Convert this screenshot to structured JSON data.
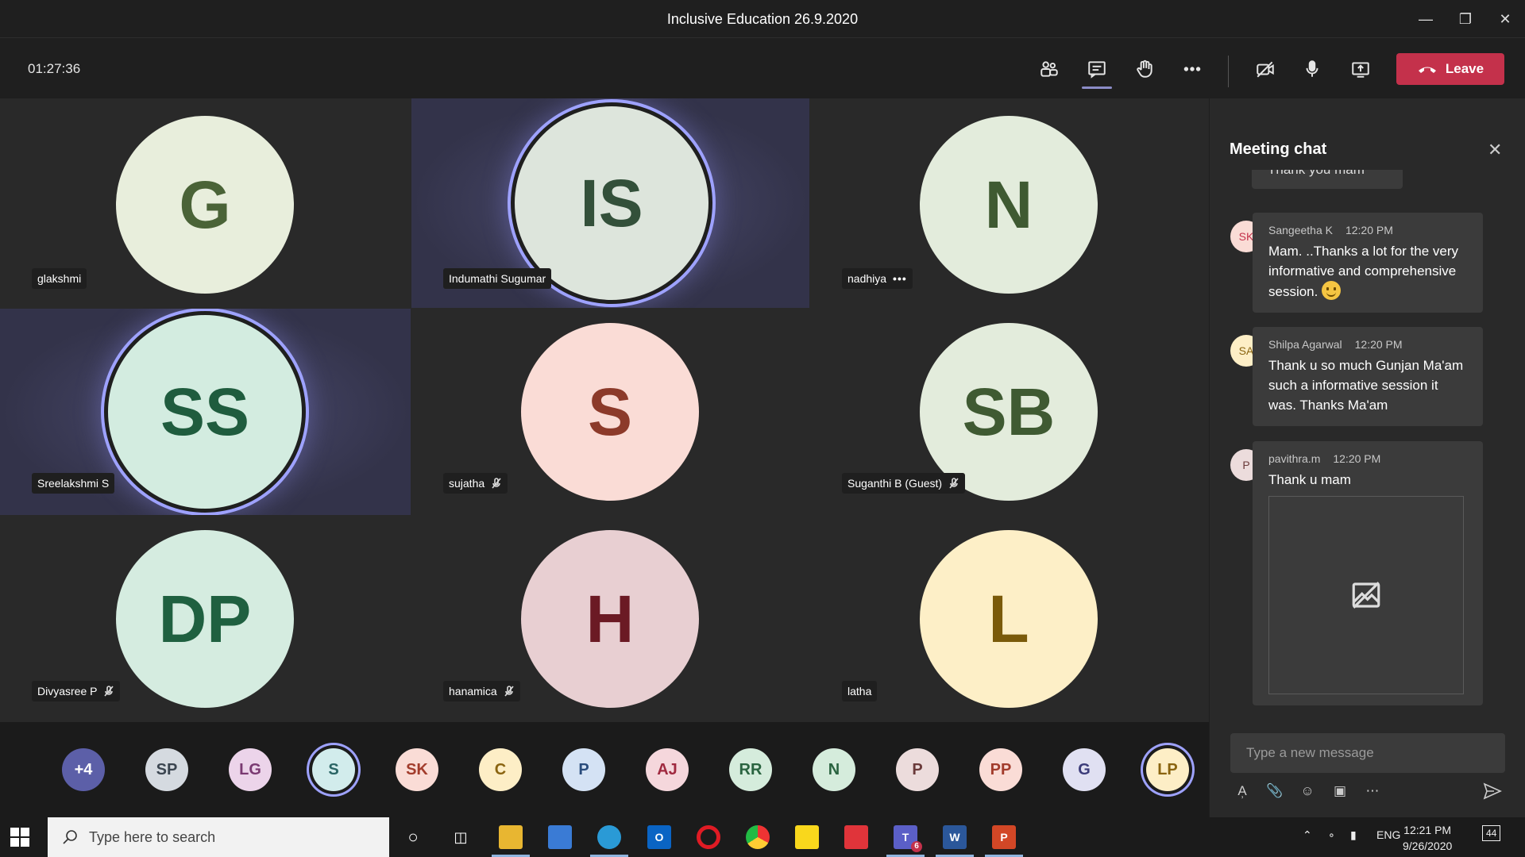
{
  "window": {
    "title": "Inclusive Education 26.9.2020"
  },
  "toolbar": {
    "timer": "01:27:36",
    "leave_label": "Leave"
  },
  "tiles": [
    {
      "initials": "G",
      "name": "glakshmi",
      "bg": "#e8eedc",
      "fg": "#4a6337"
    },
    {
      "initials": "IS",
      "name": "Indumathi Sugumar",
      "bg": "#dde5dc",
      "fg": "#33503a"
    },
    {
      "initials": "N",
      "name": "nadhiya",
      "bg": "#e3ecdc",
      "fg": "#3f5a32"
    },
    {
      "initials": "SS",
      "name": "Sreelakshmi S",
      "bg": "#d3ece0",
      "fg": "#1f5c3e"
    },
    {
      "initials": "S",
      "name": "sujatha",
      "bg": "#fadcd6",
      "fg": "#8c3a2a"
    },
    {
      "initials": "SB",
      "name": "Suganthi B (Guest)",
      "bg": "#e3ecdc",
      "fg": "#3f5a32"
    },
    {
      "initials": "DP",
      "name": "Divyasree P",
      "bg": "#d5ece0",
      "fg": "#1f6040"
    },
    {
      "initials": "H",
      "name": "hanamica",
      "bg": "#e8cfd2",
      "fg": "#6b1a24"
    },
    {
      "initials": "L",
      "name": "latha",
      "bg": "#fdefc7",
      "fg": "#7a5a0a"
    }
  ],
  "strip": [
    {
      "initials": "+4",
      "bg": "#5c5fa8",
      "fg": "#ffffff"
    },
    {
      "initials": "SP",
      "bg": "#d5dae0",
      "fg": "#3b4550"
    },
    {
      "initials": "LG",
      "bg": "#ecd4ea",
      "fg": "#7a3a72"
    },
    {
      "initials": "S",
      "bg": "#d2ecec",
      "fg": "#2a6464"
    },
    {
      "initials": "SK",
      "bg": "#fadcd6",
      "fg": "#a23c2c"
    },
    {
      "initials": "C",
      "bg": "#fdeec6",
      "fg": "#8a6410"
    },
    {
      "initials": "P",
      "bg": "#d4e2f4",
      "fg": "#2a4c7c"
    },
    {
      "initials": "AJ",
      "bg": "#f5d7dc",
      "fg": "#a02a40"
    },
    {
      "initials": "RR",
      "bg": "#d5ecdc",
      "fg": "#2a6440"
    },
    {
      "initials": "N",
      "bg": "#d5ecdc",
      "fg": "#2a6440"
    },
    {
      "initials": "P",
      "bg": "#ecdcdc",
      "fg": "#6a3a3a"
    },
    {
      "initials": "PP",
      "bg": "#fadcd6",
      "fg": "#a23c2c"
    },
    {
      "initials": "G",
      "bg": "#e0e0f2",
      "fg": "#3c3c7a"
    },
    {
      "initials": "LP",
      "bg": "#fdeec6",
      "fg": "#8a6410"
    }
  ],
  "chat": {
    "title": "Meeting chat",
    "previous_snippet": "Thank you mam",
    "messages": [
      {
        "initials": "SK",
        "sender": "Sangeetha K",
        "time": "12:20 PM",
        "text": "Mam. ..Thanks a lot for the very informative and comprehensive session."
      },
      {
        "initials": "SA",
        "sender": "Shilpa Agarwal",
        "time": "12:20 PM",
        "text": "Thank u so much Gunjan Ma'am such a informative session it was. Thanks Ma'am"
      },
      {
        "initials": "P",
        "sender": "pavithra.m",
        "time": "12:20 PM",
        "text": "Thank u mam"
      }
    ],
    "compose_placeholder": "Type a new message"
  },
  "taskbar": {
    "search_placeholder": "Type here to search",
    "language": "ENG",
    "time": "12:21 PM",
    "date": "9/26/2020",
    "notifications": "44",
    "teams_badge": "6"
  }
}
